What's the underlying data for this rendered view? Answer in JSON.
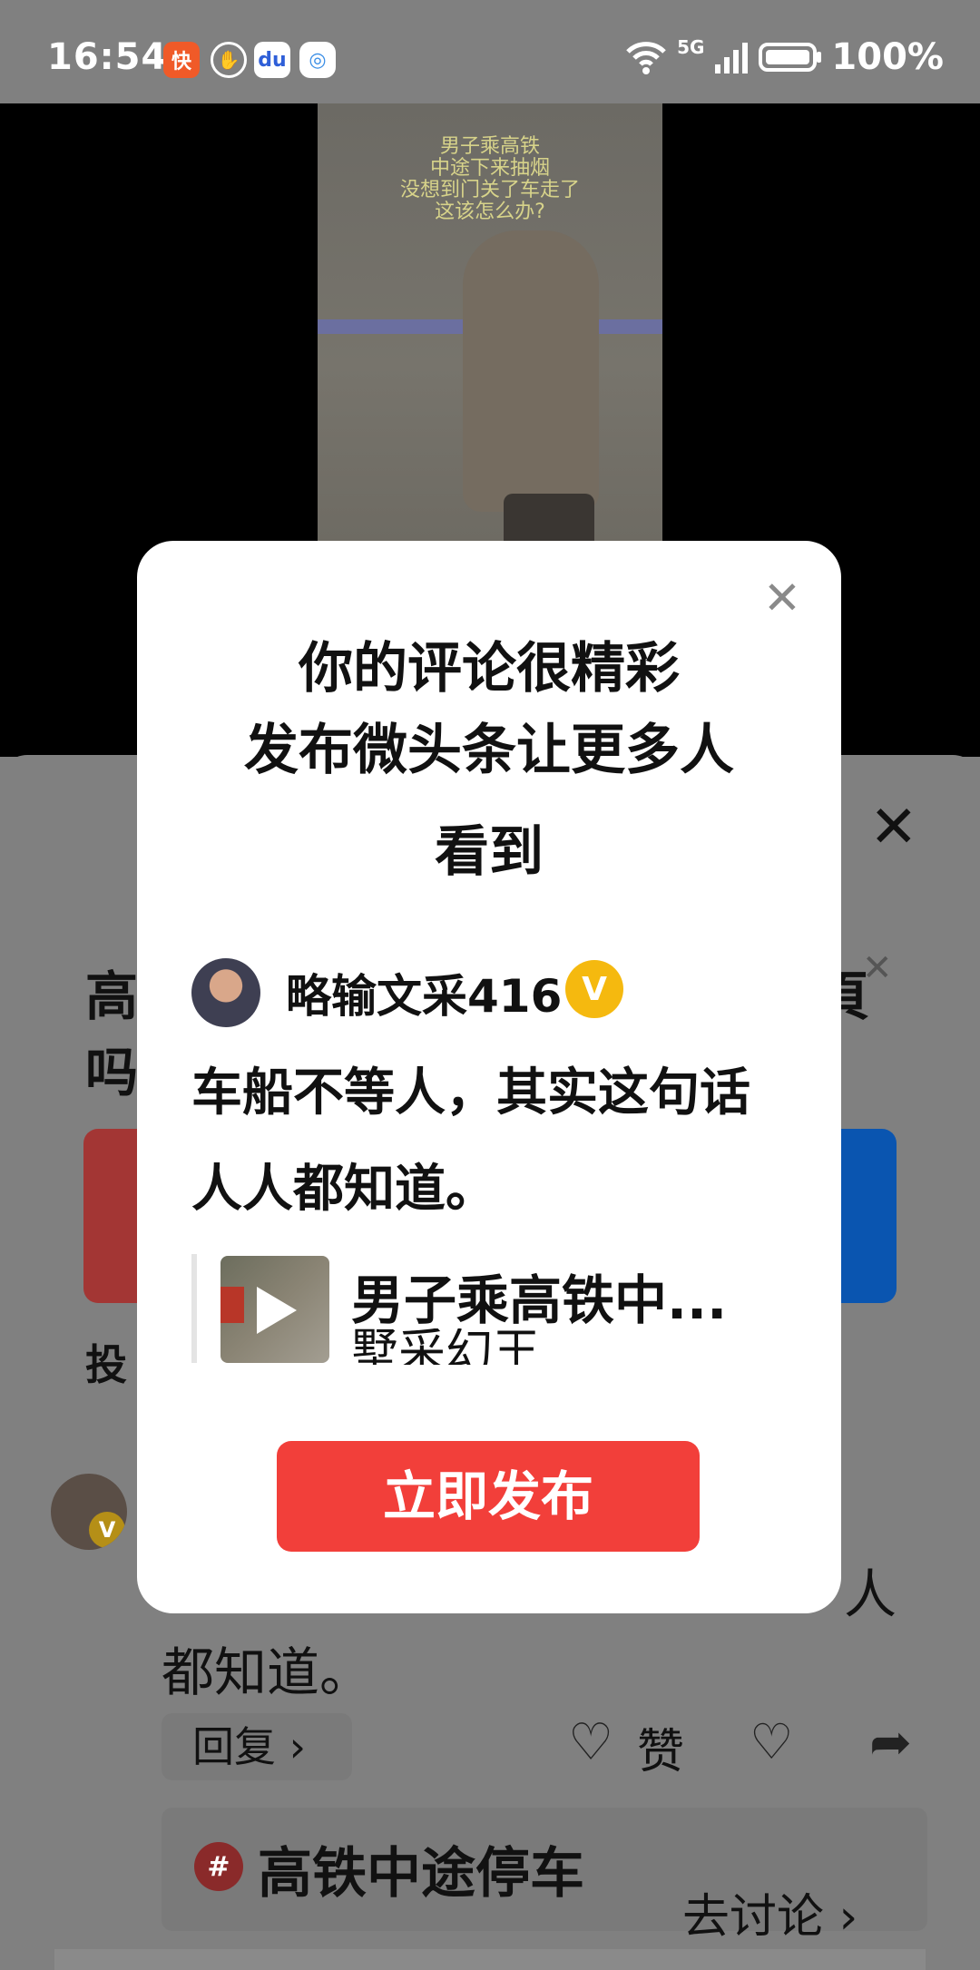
{
  "status_bar": {
    "time": "16:54",
    "battery": "100%",
    "network": "5G",
    "icons": [
      "kuaishou-icon",
      "hand-icon",
      "baidu-icon",
      "browser-icon",
      "wifi-icon",
      "signal-icon",
      "battery-icon"
    ]
  },
  "video": {
    "caption_lines": [
      "男子乘高铁",
      "中途下来抽烟",
      "没想到门关了车走了",
      "这该怎么办?"
    ]
  },
  "background": {
    "title_left": [
      "高",
      "吗"
    ],
    "vote_prefix": "投",
    "comment_tail": "人",
    "comment_line2": "都知道。",
    "reply_label": "回复 ›",
    "like_label": "赞",
    "topic_text": "高铁中途停车",
    "topic_action": "去讨论 ›"
  },
  "modal": {
    "title_lines": [
      "你的评论很精彩",
      "发布微头条让更多人",
      "看到"
    ],
    "username": "略输文采416",
    "verified_badge": "V",
    "comment_text": "车船不等人，其实这句话人人都知道。",
    "linked_title": "男子乘高铁中...",
    "linked_subtitle": "墅采幻王",
    "publish_label": "立即发布"
  }
}
